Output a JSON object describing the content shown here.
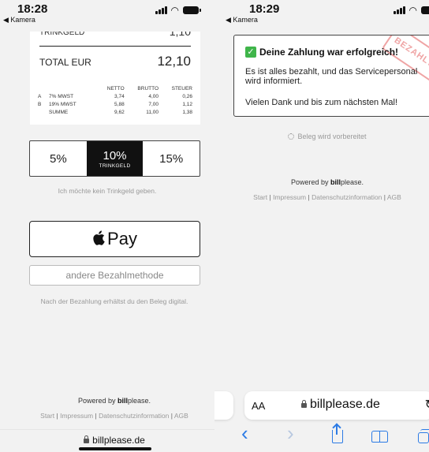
{
  "left": {
    "status": {
      "time": "18:28",
      "back_label": "Kamera"
    },
    "receipt": {
      "trinkgeld_label": "TRINKGELD",
      "trinkgeld_value": "1,10",
      "total_label": "TOTAL EUR",
      "total_value": "12,10",
      "headers": [
        "NETTO",
        "BRUTTO",
        "STEUER"
      ],
      "rows": [
        {
          "code": "A",
          "label": "7% MWST",
          "netto": "3,74",
          "brutto": "4,00",
          "steuer": "0,26"
        },
        {
          "code": "B",
          "label": "19% MWST",
          "netto": "5,88",
          "brutto": "7,00",
          "steuer": "1,12"
        },
        {
          "code": "",
          "label": "SUMME",
          "netto": "9,62",
          "brutto": "11,00",
          "steuer": "1,38"
        }
      ]
    },
    "tips": [
      {
        "label": "5%",
        "sub": ""
      },
      {
        "label": "10%",
        "sub": "TRINKGELD"
      },
      {
        "label": "15%",
        "sub": ""
      }
    ],
    "no_tip": "Ich möchte kein Trinkgeld geben.",
    "apple_pay_label": "Pay",
    "other_pay_label": "andere Bezahlmethode",
    "after_note": "Nach der Bezahlung erhältst du den Beleg digital.",
    "powered_prefix": "Powered by ",
    "powered_brand": "bill",
    "powered_suffix": "please.",
    "links": [
      "Start",
      "Impressum",
      "Datenschutzinformation",
      "AGB"
    ],
    "url": "billplease.de"
  },
  "right": {
    "status": {
      "time": "18:29",
      "back_label": "Kamera"
    },
    "success": {
      "title": "Deine Zahlung war erfolgreich!",
      "text": "Es ist alles bezahlt, und das Servicepersonal wird informiert.",
      "thanks": "Vielen Dank und bis zum nächsten Mal!",
      "stamp": "BEZAHLT"
    },
    "preparing": "Beleg wird vorbereitet",
    "powered_prefix": "Powered by ",
    "powered_brand": "bill",
    "powered_suffix": "please.",
    "links": [
      "Start",
      "Impressum",
      "Datenschutzinformation",
      "AGB"
    ],
    "safari": {
      "aa_label": "AA",
      "domain": "billplease.de",
      "reload_icon": "↻",
      "back_icon": "‹",
      "forward_icon": "›"
    }
  },
  "colors": {
    "success_green": "#3fb54a",
    "stamp_red": "#e35a5a",
    "safari_blue": "#2c7be5",
    "selected_tip": "#111111"
  }
}
